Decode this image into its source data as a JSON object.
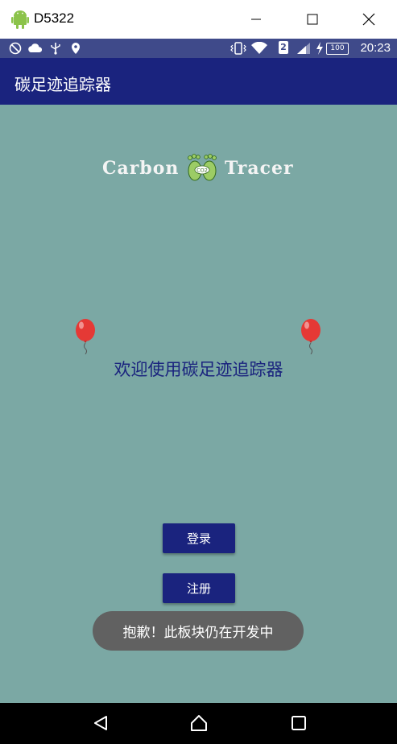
{
  "window": {
    "title": "D5322",
    "minimize_glyph": "—",
    "maximize_glyph": "☐",
    "close_glyph": "✕"
  },
  "status_bar": {
    "time": "20:23",
    "sim_label": "2",
    "battery_label": "100",
    "icons": [
      "no-notification-icon",
      "cloud-icon",
      "usb-icon",
      "location-icon",
      "vibrate-icon",
      "wifi-icon",
      "sim-icon",
      "signal-icon",
      "charging-icon",
      "battery-icon"
    ]
  },
  "app_bar": {
    "title": "碳足迹追踪器"
  },
  "logo": {
    "left_text": "Carbon",
    "right_text": "Tracer",
    "footprint_badge": "CO2"
  },
  "welcome": {
    "text": "欢迎使用碳足迹追踪器"
  },
  "buttons": {
    "login": "登录",
    "register": "注册"
  },
  "toast": {
    "text": "抱歉！此板块仍在开发中"
  },
  "colors": {
    "background": "#7ba8a4",
    "primary": "#1a237e",
    "status_bar": "#3f4a8a",
    "toast": "#616161",
    "balloon": "#e53935"
  }
}
